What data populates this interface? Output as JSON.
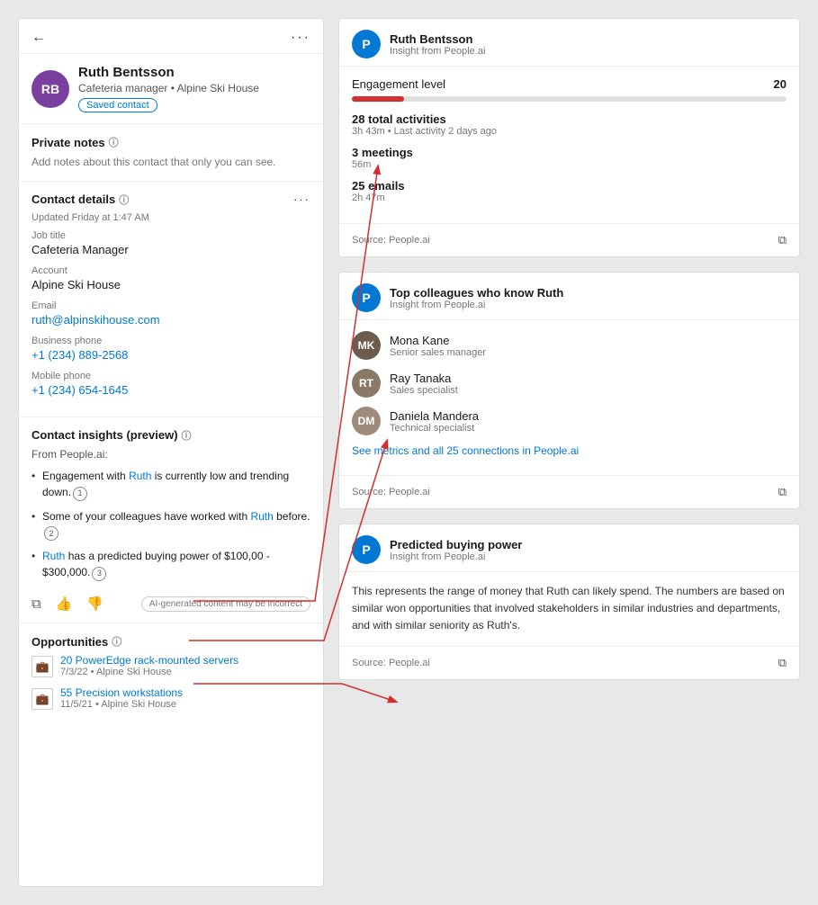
{
  "contact": {
    "initials": "RB",
    "name": "Ruth Bentsson",
    "subtitle": "Cafeteria manager • Alpine Ski House",
    "saved_label": "Saved contact",
    "updated": "Updated Friday at 1:47 AM",
    "job_title_label": "Job title",
    "job_title": "Cafeteria Manager",
    "account_label": "Account",
    "account": "Alpine Ski House",
    "email_label": "Email",
    "email": "ruth@alpinskihouse.com",
    "business_phone_label": "Business phone",
    "business_phone": "+1 (234) 889-2568",
    "mobile_phone_label": "Mobile phone",
    "mobile_phone": "+1 (234) 654-1645"
  },
  "private_notes": {
    "title": "Private notes",
    "placeholder": "Add notes about this contact that only you can see."
  },
  "contact_details": {
    "title": "Contact details"
  },
  "contact_insights": {
    "title": "Contact insights (preview)",
    "from_label": "From People.ai:",
    "insight1_before": "Engagement with ",
    "insight1_name": "Ruth",
    "insight1_after": " is currently low and trending down.",
    "insight1_badge": "1",
    "insight2_before": "Some of your colleagues have worked with ",
    "insight2_name": "Ruth",
    "insight2_after": " before.",
    "insight2_badge": "2",
    "insight3_before": "",
    "insight3_name": "Ruth",
    "insight3_after": " has a predicted buying power of $100,00 - $300,000.",
    "insight3_badge": "3",
    "ai_disclaimer": "AI-generated content may be incorrect"
  },
  "opportunities": {
    "title": "Opportunities",
    "items": [
      {
        "title": "20 PowerEdge rack-mounted servers",
        "meta": "7/3/22 • Alpine Ski House"
      },
      {
        "title": "55 Precision workstations",
        "meta": "11/5/21 • Alpine Ski House"
      }
    ]
  },
  "engagement_card": {
    "avatar_letter": "P",
    "title": "Ruth Bentsson",
    "subtitle": "Insight from People.ai",
    "engagement_label": "Engagement level",
    "engagement_score": "20",
    "progress_pct": 12,
    "activities_title": "28 total activities",
    "activities_sub": "3h 43m • Last activity 2 days ago",
    "meetings_title": "3 meetings",
    "meetings_sub": "56m",
    "emails_title": "25 emails",
    "emails_sub": "2h 47m",
    "source": "Source: People.ai"
  },
  "colleagues_card": {
    "avatar_letter": "P",
    "title": "Top colleagues who know Ruth",
    "subtitle": "Insight from People.ai",
    "colleagues": [
      {
        "initials": "MK",
        "color": "#6b5c4e",
        "name": "Mona Kane",
        "role": "Senior sales manager"
      },
      {
        "initials": "RT",
        "color": "#8a7968",
        "name": "Ray Tanaka",
        "role": "Sales specialist"
      },
      {
        "initials": "DM",
        "color": "#9e8b7a",
        "name": "Daniela Mandera",
        "role": "Technical specialist"
      }
    ],
    "see_metrics": "See metrics and all 25 connections in People.ai",
    "source": "Source: People.ai"
  },
  "buying_power_card": {
    "avatar_letter": "P",
    "title": "Predicted buying power",
    "subtitle": "Insight from People.ai",
    "body": "This represents the range of money that Ruth can likely spend. The numbers are based on similar won opportunities that involved stakeholders in similar industries and departments, and with similar seniority as Ruth's.",
    "source": "Source: People.ai"
  },
  "icons": {
    "back": "←",
    "more": "···",
    "info": "ⓘ",
    "copy": "⧉",
    "thumbup": "👍",
    "thumbdown": "👎",
    "external": "⧉",
    "briefcase": "💼"
  }
}
